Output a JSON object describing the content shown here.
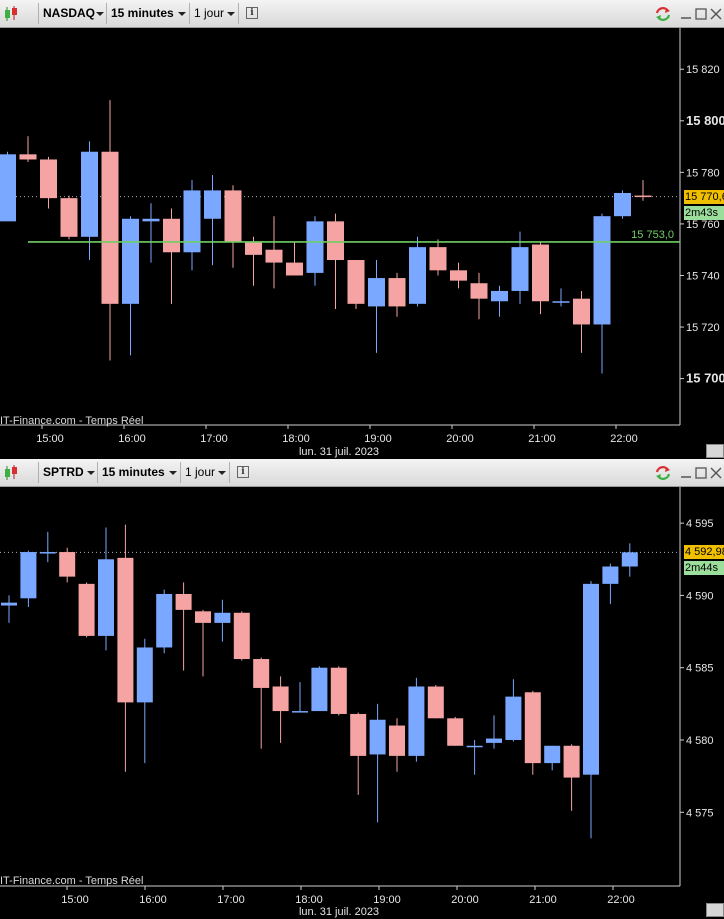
{
  "panels": [
    {
      "symbol": "NASDAQ",
      "interval": "15 minutes",
      "period": "1 jour",
      "info_glyph": "i",
      "price_badge": "15 770,6",
      "timer_badge": "2m43s",
      "line_label": "15 753,0",
      "credit": "IT-Finance.com - Temps Réel",
      "date_label": "lun. 31 juil. 2023",
      "icons": [
        "refresh-icon",
        "minimize-icon",
        "maximize-icon",
        "close-icon",
        "info-icon",
        "candlestick-icon",
        "resize-icon"
      ],
      "colors": {
        "up": "#7aa7ff",
        "down": "#f5a3a3",
        "line": "#6fcf63",
        "price": "#f0c000",
        "timer": "#9bdd9b"
      }
    },
    {
      "symbol": "SPTRD",
      "interval": "15 minutes",
      "period": "1 jour",
      "info_glyph": "i",
      "price_badge": "4 592,98",
      "timer_badge": "2m44s",
      "credit": "IT-Finance.com - Temps Réel",
      "date_label": "lun. 31 juil. 2023",
      "icons": [
        "refresh-icon",
        "minimize-icon",
        "maximize-icon",
        "close-icon",
        "info-icon",
        "candlestick-icon",
        "resize-icon"
      ],
      "colors": {
        "up": "#7aa7ff",
        "down": "#f5a3a3",
        "price": "#f0c000",
        "timer": "#9bdd9b"
      }
    }
  ],
  "chart_data": [
    {
      "type": "candlestick",
      "ylim": [
        15682,
        15836
      ],
      "y_ticks": [
        15700,
        15720,
        15740,
        15760,
        15780,
        15800,
        15820
      ],
      "y_tick_labels": [
        "15 700",
        "15 720",
        "15 740",
        "15 760",
        "15 780",
        "15 800",
        "15 820"
      ],
      "x_ticks": [
        "15:00",
        "16:00",
        "17:00",
        "18:00",
        "19:00",
        "20:00",
        "21:00",
        "22:00"
      ],
      "horizontal_line": 15753.0,
      "last_price": 15770.6,
      "candles": [
        {
          "o": 15761,
          "h": 15788,
          "l": 15767,
          "c": 15787
        },
        {
          "o": 15787,
          "h": 15794,
          "l": 15784,
          "c": 15785
        },
        {
          "o": 15785,
          "h": 15786,
          "l": 15766,
          "c": 15770
        },
        {
          "o": 15770,
          "h": 15771,
          "l": 15754,
          "c": 15755
        },
        {
          "o": 15755,
          "h": 15792,
          "l": 15746,
          "c": 15788
        },
        {
          "o": 15788,
          "h": 15808,
          "l": 15707,
          "c": 15729
        },
        {
          "o": 15729,
          "h": 15763,
          "l": 15709,
          "c": 15762
        },
        {
          "o": 15761,
          "h": 15768,
          "l": 15745,
          "c": 15762
        },
        {
          "o": 15762,
          "h": 15766,
          "l": 15729,
          "c": 15749
        },
        {
          "o": 15749,
          "h": 15777,
          "l": 15742,
          "c": 15773
        },
        {
          "o": 15762,
          "h": 15779,
          "l": 15744,
          "c": 15773
        },
        {
          "o": 15773,
          "h": 15775,
          "l": 15743,
          "c": 15753
        },
        {
          "o": 15753,
          "h": 15755,
          "l": 15736,
          "c": 15748
        },
        {
          "o": 15750,
          "h": 15763,
          "l": 15735,
          "c": 15745
        },
        {
          "o": 15745,
          "h": 15753,
          "l": 15740,
          "c": 15740
        },
        {
          "o": 15741,
          "h": 15763,
          "l": 15736,
          "c": 15761
        },
        {
          "o": 15761,
          "h": 15764,
          "l": 15727,
          "c": 15746
        },
        {
          "o": 15746,
          "h": 15746,
          "l": 15727,
          "c": 15729
        },
        {
          "o": 15728,
          "h": 15746,
          "l": 15710,
          "c": 15739
        },
        {
          "o": 15739,
          "h": 15741,
          "l": 15724,
          "c": 15728
        },
        {
          "o": 15729,
          "h": 15755,
          "l": 15728,
          "c": 15751
        },
        {
          "o": 15751,
          "h": 15754,
          "l": 15740,
          "c": 15742
        },
        {
          "o": 15742,
          "h": 15745,
          "l": 15735,
          "c": 15738
        },
        {
          "o": 15737,
          "h": 15741,
          "l": 15723,
          "c": 15731
        },
        {
          "o": 15730,
          "h": 15736,
          "l": 15724,
          "c": 15734
        },
        {
          "o": 15734,
          "h": 15757,
          "l": 15729,
          "c": 15751
        },
        {
          "o": 15752,
          "h": 15753,
          "l": 15725,
          "c": 15730
        },
        {
          "o": 15730,
          "h": 15735,
          "l": 15728,
          "c": 15730
        },
        {
          "o": 15731,
          "h": 15734,
          "l": 15710,
          "c": 15721
        },
        {
          "o": 15721,
          "h": 15764,
          "l": 15702,
          "c": 15763
        },
        {
          "o": 15763,
          "h": 15773,
          "l": 15762,
          "c": 15772
        },
        {
          "o": 15771,
          "h": 15777,
          "l": 15769,
          "c": 15770.6
        }
      ]
    },
    {
      "type": "candlestick",
      "ylim": [
        4569.9,
        4597.5
      ],
      "y_ticks": [
        4575,
        4580,
        4585,
        4590,
        4595
      ],
      "y_tick_labels": [
        "4 575",
        "4 580",
        "4 585",
        "4 590",
        "4 595"
      ],
      "x_ticks": [
        "15:00",
        "16:00",
        "17:00",
        "18:00",
        "19:00",
        "20:00",
        "21:00",
        "22:00"
      ],
      "last_price": 4592.98,
      "candles": [
        {
          "o": 4589.3,
          "h": 4590.0,
          "l": 4588.1,
          "c": 4589.5
        },
        {
          "o": 4589.8,
          "h": 4593.1,
          "l": 4589.2,
          "c": 4593.0
        },
        {
          "o": 4592.9,
          "h": 4594.4,
          "l": 4592.3,
          "c": 4593.0
        },
        {
          "o": 4593.0,
          "h": 4593.3,
          "l": 4590.9,
          "c": 4591.3
        },
        {
          "o": 4590.8,
          "h": 4590.9,
          "l": 4587.1,
          "c": 4587.2
        },
        {
          "o": 4587.2,
          "h": 4594.7,
          "l": 4586.2,
          "c": 4592.5
        },
        {
          "o": 4592.6,
          "h": 4594.9,
          "l": 4577.8,
          "c": 4582.6
        },
        {
          "o": 4582.6,
          "h": 4587.0,
          "l": 4578.4,
          "c": 4586.4
        },
        {
          "o": 4586.4,
          "h": 4590.4,
          "l": 4586.0,
          "c": 4590.1
        },
        {
          "o": 4590.1,
          "h": 4590.9,
          "l": 4584.8,
          "c": 4589.0
        },
        {
          "o": 4588.9,
          "h": 4589.0,
          "l": 4584.4,
          "c": 4588.1
        },
        {
          "o": 4588.1,
          "h": 4589.7,
          "l": 4586.8,
          "c": 4588.8
        },
        {
          "o": 4588.8,
          "h": 4588.9,
          "l": 4585.5,
          "c": 4585.6
        },
        {
          "o": 4585.6,
          "h": 4585.7,
          "l": 4579.4,
          "c": 4583.6
        },
        {
          "o": 4583.7,
          "h": 4584.4,
          "l": 4579.8,
          "c": 4582.0
        },
        {
          "o": 4582.0,
          "h": 4584.0,
          "l": 4582.0,
          "c": 4582.0
        },
        {
          "o": 4582.0,
          "h": 4585.1,
          "l": 4582.0,
          "c": 4585.0
        },
        {
          "o": 4585.0,
          "h": 4585.1,
          "l": 4581.7,
          "c": 4581.8
        },
        {
          "o": 4581.8,
          "h": 4581.9,
          "l": 4576.2,
          "c": 4578.9
        },
        {
          "o": 4579.0,
          "h": 4582.5,
          "l": 4574.3,
          "c": 4581.4
        },
        {
          "o": 4581.0,
          "h": 4581.5,
          "l": 4577.8,
          "c": 4578.9
        },
        {
          "o": 4578.9,
          "h": 4584.3,
          "l": 4578.5,
          "c": 4583.7
        },
        {
          "o": 4583.7,
          "h": 4583.8,
          "l": 4581.5,
          "c": 4581.5
        },
        {
          "o": 4581.5,
          "h": 4581.6,
          "l": 4579.6,
          "c": 4579.6
        },
        {
          "o": 4579.6,
          "h": 4580.0,
          "l": 4577.6,
          "c": 4579.6
        },
        {
          "o": 4579.8,
          "h": 4581.7,
          "l": 4579.4,
          "c": 4580.1
        },
        {
          "o": 4580.0,
          "h": 4584.2,
          "l": 4579.9,
          "c": 4583.0
        },
        {
          "o": 4583.3,
          "h": 4583.4,
          "l": 4577.6,
          "c": 4578.4
        },
        {
          "o": 4578.4,
          "h": 4579.6,
          "l": 4577.9,
          "c": 4579.6
        },
        {
          "o": 4579.6,
          "h": 4579.7,
          "l": 4575.1,
          "c": 4577.4
        },
        {
          "o": 4577.6,
          "h": 4591.0,
          "l": 4573.2,
          "c": 4590.8
        },
        {
          "o": 4590.8,
          "h": 4592.2,
          "l": 4589.4,
          "c": 4592.0
        },
        {
          "o": 4592.0,
          "h": 4593.6,
          "l": 4591.3,
          "c": 4592.98
        }
      ]
    }
  ]
}
